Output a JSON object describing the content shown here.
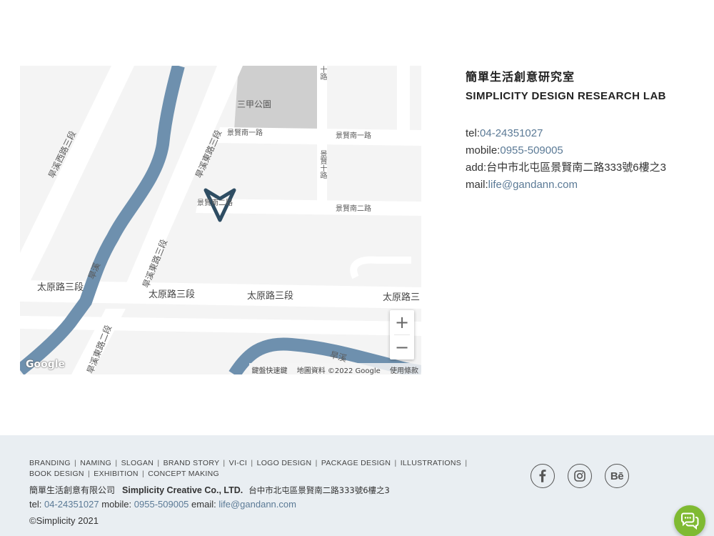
{
  "map": {
    "labels": {
      "park": "三甲公園",
      "jingxian_s1_left": "景賢南一路",
      "jingxian_s1_right": "景賢南一路",
      "jingxian_s2_left": "景賢南二路",
      "jingxian_s2_right": "景賢南二路",
      "jingxian_10": "景賢十路",
      "jingxian_10_top": "十路",
      "fuxi_west": "旱溪西路三段",
      "fuxi_east_top": "旱溪東路三段",
      "fuxi_east_mid": "旱溪東路三段",
      "fuxi_east_bottom": "旱溪東路二段",
      "river": "旱溪",
      "river_bottom": "旱溪",
      "taiyuan_1": "太原路三段",
      "taiyuan_2": "太原路三段",
      "taiyuan_3": "太原路三段",
      "taiyuan_4": "太原路三"
    },
    "zoom_in": "+",
    "zoom_out": "−",
    "google_logo": "Google",
    "attribution": {
      "shortcuts": "鍵盤快速鍵",
      "data": "地圖資料 ©2022 Google",
      "terms": "使用條款"
    },
    "marker_icon": "navigation-arrow-icon"
  },
  "contact": {
    "name_zh": "簡單生活創意研究室",
    "name_en": "SIMPLICITY DESIGN RESEARCH LAB",
    "tel_label": "tel:",
    "tel": "04-24351027",
    "mobile_label": "mobile:",
    "mobile": "0955-509005",
    "addr_label": "add:",
    "addr": "台中市北屯區景賢南二路333號6樓之3",
    "mail_label": "mail:",
    "mail": "life@gandann.com",
    "link_color": "#5b7a96"
  },
  "footer": {
    "nav": [
      "BRANDING",
      "NAMING",
      "SLOGAN",
      "BRAND STORY",
      "VI-CI",
      "LOGO DESIGN",
      "PACKAGE DESIGN",
      "ILLUSTRATIONS",
      "BOOK DESIGN",
      "EXHIBITION",
      "CONCEPT MAKING"
    ],
    "separator": "|",
    "company_zh": "簡單生活創意有限公司",
    "company_en": "Simplicity Creative Co., LTD.",
    "company_addr": "台中市北屯區景賢南二路333號6樓之3",
    "tel_label": "tel:",
    "tel": "04-24351027",
    "mobile_label": "mobile:",
    "mobile": "0955-509005",
    "email_label": "email:",
    "email": "life@gandann.com",
    "copyright": "©Simplicity 2021",
    "background": "#e9eef2",
    "social": [
      {
        "name": "facebook-icon"
      },
      {
        "name": "instagram-icon"
      },
      {
        "name": "behance-icon",
        "text": "Bē"
      }
    ],
    "chat_icon": "chat-bubbles-icon",
    "chat_color": "#7fba32"
  }
}
